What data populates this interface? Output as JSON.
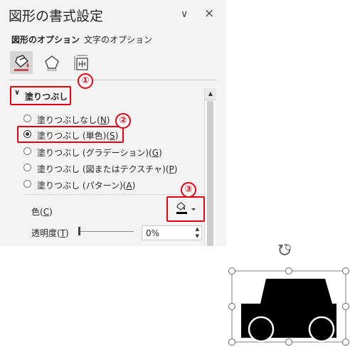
{
  "pane": {
    "title": "図形の書式設定",
    "pin_glyph": "∨",
    "close_glyph": "×",
    "tabs": [
      {
        "label": "図形のオプション",
        "selected": true
      },
      {
        "label": "文字のオプション",
        "selected": false
      }
    ],
    "icons": [
      "fill-line-icon",
      "effects-icon",
      "size-properties-icon"
    ],
    "section": {
      "label": "塗りつぶし",
      "expanded": true
    },
    "fill_options": [
      {
        "label": "塗りつぶしなし(",
        "key": "N",
        "suffix": ")",
        "selected": false
      },
      {
        "label": "塗りつぶし (単色)(",
        "key": "S",
        "suffix": ")",
        "selected": true
      },
      {
        "label": "塗りつぶし (グラデーション)(",
        "key": "G",
        "suffix": ")",
        "selected": false
      },
      {
        "label": "塗りつぶし (図またはテクスチャ)(",
        "key": "P",
        "suffix": ")",
        "selected": false
      },
      {
        "label": "塗りつぶし (パターン)(",
        "key": "A",
        "suffix": ")",
        "selected": false
      }
    ],
    "color": {
      "label": "色(",
      "key": "C",
      "suffix": ")",
      "swatch": "#000000"
    },
    "opacity": {
      "label": "透明度(",
      "key": "T",
      "suffix": ")",
      "value": "0%",
      "fraction": 0
    }
  },
  "annotations": {
    "badge1": "①",
    "badge2": "②",
    "badge3": "③",
    "color": "#e60012"
  },
  "shape": {
    "fill": "#000000"
  }
}
